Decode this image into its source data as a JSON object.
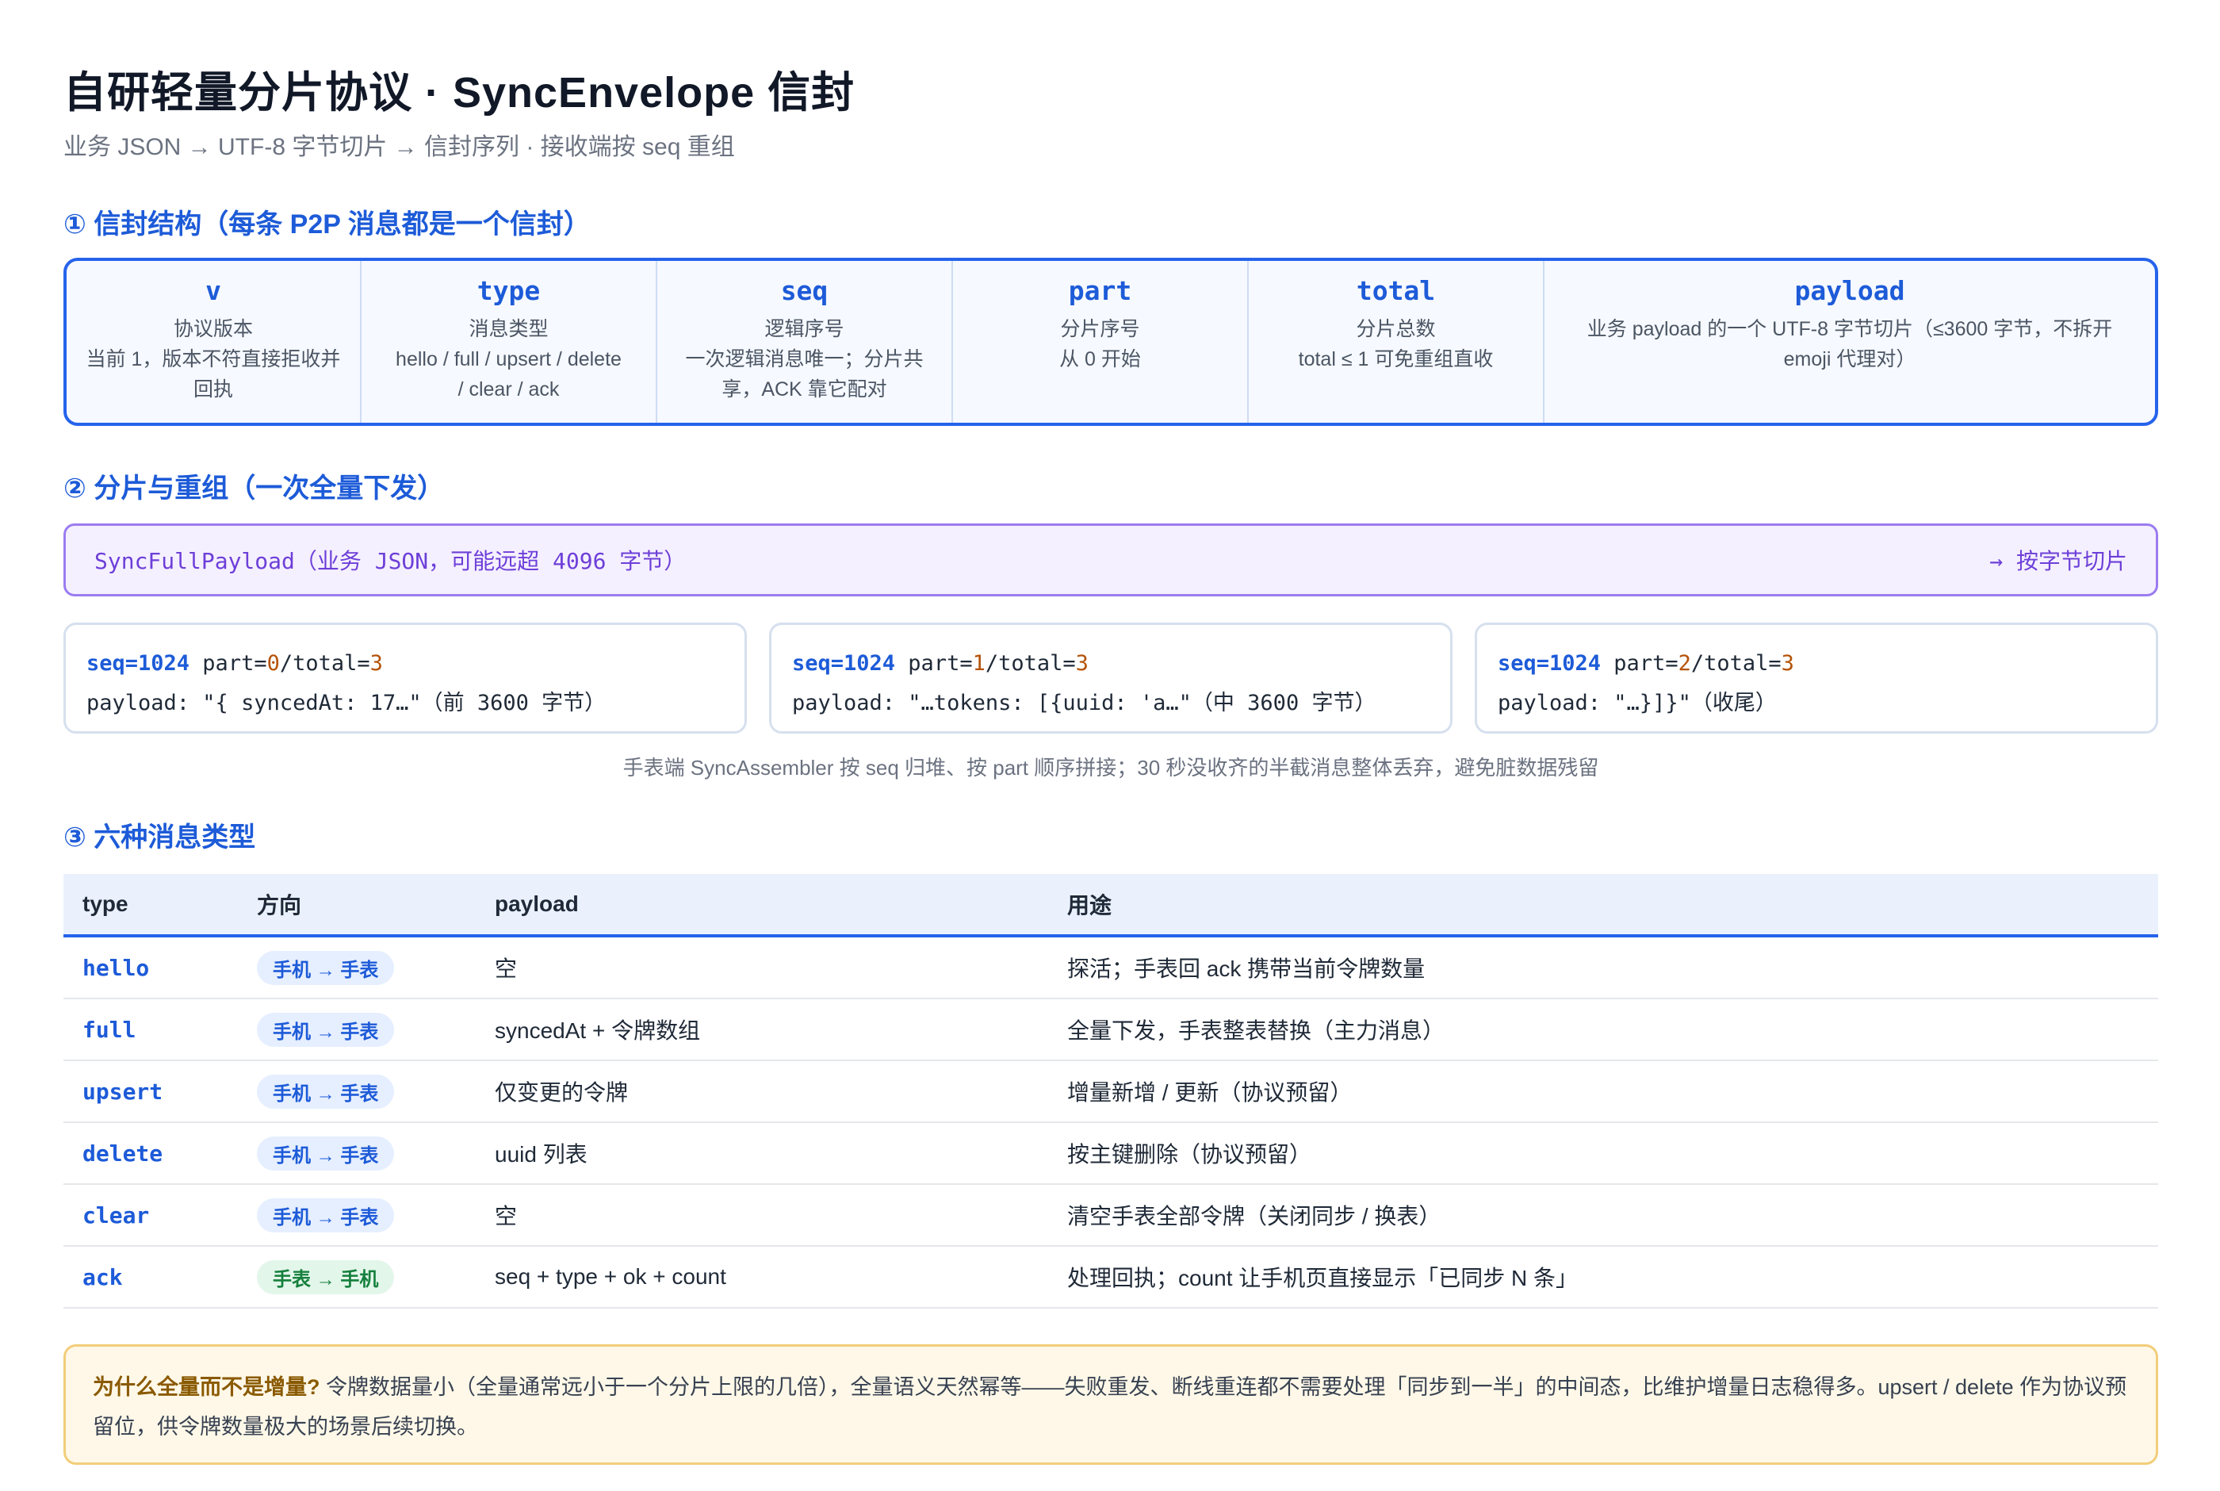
{
  "header": {
    "title": "自研轻量分片协议 · SyncEnvelope 信封",
    "subtitle": "业务 JSON → UTF-8 字节切片 → 信封序列 · 接收端按 seq 重组"
  },
  "section1": {
    "heading": "① 信封结构（每条 P2P 消息都是一个信封）",
    "fields": [
      {
        "name": "v",
        "desc": [
          "协议版本",
          "当前 1，版本不符直接拒收并",
          "回执"
        ]
      },
      {
        "name": "type",
        "desc": [
          "消息类型",
          "hello / full / upsert / delete",
          "/ clear / ack"
        ]
      },
      {
        "name": "seq",
        "desc": [
          "逻辑序号",
          "一次逻辑消息唯一；分片共",
          "享，ACK 靠它配对"
        ]
      },
      {
        "name": "part",
        "desc": [
          "分片序号",
          "从 0 开始"
        ]
      },
      {
        "name": "total",
        "desc": [
          "分片总数",
          "total ≤ 1 可免重组直收"
        ]
      },
      {
        "name": "payload",
        "desc": [
          "业务 payload 的一个 UTF-8 字节切片（≤3600 字节，不拆开",
          "emoji 代理对）"
        ]
      }
    ]
  },
  "section2": {
    "heading": "② 分片与重组（一次全量下发）",
    "source_label": "SyncFullPayload（业务 JSON，可能远超 4096 字节）",
    "source_action": "→ 按字节切片",
    "chunks": [
      {
        "seq": "seq=1024",
        "part_label": " part=",
        "part": "0",
        "total_label": "/total=",
        "total": "3",
        "payload": "payload: \"{ syncedAt: 17…\"（前 3600 字节）"
      },
      {
        "seq": "seq=1024",
        "part_label": " part=",
        "part": "1",
        "total_label": "/total=",
        "total": "3",
        "payload": "payload: \"…tokens: [{uuid: 'a…\"（中 3600 字节）"
      },
      {
        "seq": "seq=1024",
        "part_label": " part=",
        "part": "2",
        "total_label": "/total=",
        "total": "3",
        "payload": "payload: \"…}]}\"（收尾）"
      }
    ],
    "note": "手表端 SyncAssembler 按 seq 归堆、按 part 顺序拼接；30 秒没收齐的半截消息整体丢弃，避免脏数据残留"
  },
  "section3": {
    "heading": "③ 六种消息类型",
    "columns": [
      "type",
      "方向",
      "payload",
      "用途"
    ],
    "rows": [
      {
        "type": "hello",
        "direction": "手机 → 手表",
        "dir_color": "blue",
        "payload": "空",
        "purpose": "探活；手表回 ack 携带当前令牌数量"
      },
      {
        "type": "full",
        "direction": "手机 → 手表",
        "dir_color": "blue",
        "payload": "syncedAt + 令牌数组",
        "purpose": "全量下发，手表整表替换（主力消息）"
      },
      {
        "type": "upsert",
        "direction": "手机 → 手表",
        "dir_color": "blue",
        "payload": "仅变更的令牌",
        "purpose": "增量新增 / 更新（协议预留）"
      },
      {
        "type": "delete",
        "direction": "手机 → 手表",
        "dir_color": "blue",
        "payload": "uuid 列表",
        "purpose": "按主键删除（协议预留）"
      },
      {
        "type": "clear",
        "direction": "手机 → 手表",
        "dir_color": "blue",
        "payload": "空",
        "purpose": "清空手表全部令牌（关闭同步 / 换表）"
      },
      {
        "type": "ack",
        "direction": "手表 → 手机",
        "dir_color": "green",
        "payload": "seq + type + ok + count",
        "purpose": "处理回执；count 让手机页直接显示「已同步 N 条」"
      }
    ]
  },
  "why": {
    "label": "为什么全量而不是增量?",
    "text": " 令牌数据量小（全量通常远小于一个分片上限的几倍），全量语义天然幂等——失败重发、断线重连都不需要处理「同步到一半」的中间态，比维护增量日志稳得多。upsert / delete 作为协议预留位，供令牌数量极大的场景后续切换。"
  },
  "colors": {
    "accent": "#2563eb",
    "heading": "#1d5bd8",
    "purple": "#6d3fd8",
    "green": "#15803d",
    "note_bg": "#fff8e8"
  }
}
